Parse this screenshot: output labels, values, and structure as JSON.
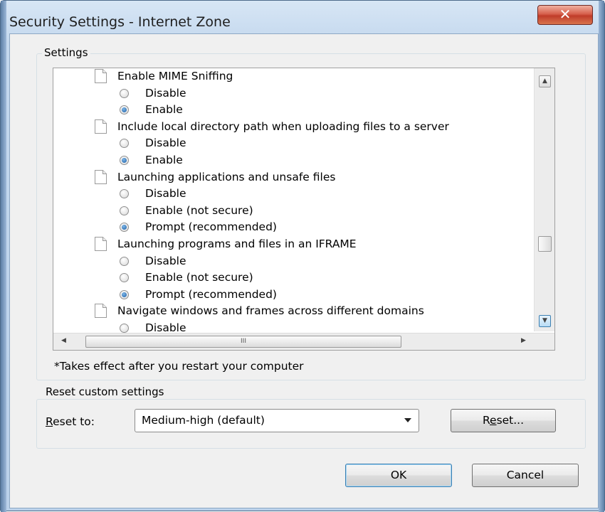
{
  "window": {
    "title": "Security Settings - Internet Zone",
    "close_glyph": "✕"
  },
  "settings_group": {
    "label": "Settings"
  },
  "settings_list": [
    {
      "kind": "category",
      "label": "Enable MIME Sniffing"
    },
    {
      "kind": "option",
      "label": "Disable",
      "selected": false
    },
    {
      "kind": "option",
      "label": "Enable",
      "selected": true
    },
    {
      "kind": "category",
      "label": "Include local directory path when uploading files to a server"
    },
    {
      "kind": "option",
      "label": "Disable",
      "selected": false
    },
    {
      "kind": "option",
      "label": "Enable",
      "selected": true
    },
    {
      "kind": "category",
      "label": "Launching applications and unsafe files"
    },
    {
      "kind": "option",
      "label": "Disable",
      "selected": false
    },
    {
      "kind": "option",
      "label": "Enable (not secure)",
      "selected": false
    },
    {
      "kind": "option",
      "label": "Prompt (recommended)",
      "selected": true
    },
    {
      "kind": "category",
      "label": "Launching programs and files in an IFRAME"
    },
    {
      "kind": "option",
      "label": "Disable",
      "selected": false
    },
    {
      "kind": "option",
      "label": "Enable (not secure)",
      "selected": false
    },
    {
      "kind": "option",
      "label": "Prompt (recommended)",
      "selected": true
    },
    {
      "kind": "category",
      "label": "Navigate windows and frames across different domains"
    },
    {
      "kind": "option",
      "label": "Disable",
      "selected": false
    }
  ],
  "scrollbars": {
    "vertical_up": "▲",
    "vertical_down": "▼",
    "horizontal_left": "◀",
    "horizontal_right": "▶",
    "horizontal_grip": "III"
  },
  "note": "*Takes effect after you restart your computer",
  "reset_group": {
    "label": "Reset custom settings",
    "reset_to_prefix": "R",
    "reset_to_rest": "eset to:",
    "dropdown_value": "Medium-high (default)",
    "reset_button_prefix": "R",
    "reset_button_mnemonic": "e",
    "reset_button_rest": "set..."
  },
  "footer": {
    "ok_label": "OK",
    "cancel_label": "Cancel"
  },
  "colors": {
    "accent": "#3c7fb1",
    "close": "#c03c2a"
  }
}
